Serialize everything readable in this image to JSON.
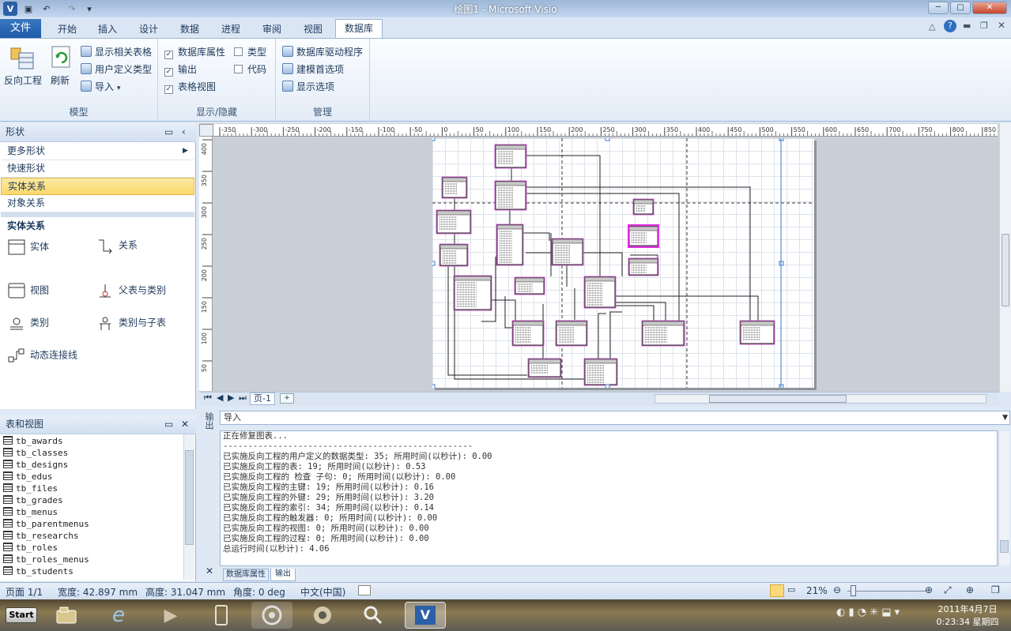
{
  "window": {
    "title": "绘图1 - Microsoft Visio"
  },
  "tabs": {
    "file": "文件",
    "items": [
      "开始",
      "插入",
      "设计",
      "数据",
      "进程",
      "审阅",
      "视图",
      "数据库"
    ]
  },
  "ribbon": {
    "model_group": {
      "label": "模型",
      "reverse": "反向工程",
      "refresh": "刷新",
      "show_related": "显示相关表格",
      "udt": "用户定义类型",
      "import": "导入"
    },
    "show_group": {
      "label": "显示/隐藏",
      "db_props": "数据库属性",
      "output": "输出",
      "table_view": "表格视图",
      "types": "类型",
      "code": "代码"
    },
    "manage_group": {
      "label": "管理",
      "driver": "数据库驱动程序",
      "modeling": "建模首选项",
      "display": "显示选项"
    }
  },
  "shapes_pane": {
    "title": "形状",
    "items": [
      "更多形状",
      "快速形状",
      "实体关系",
      "对象关系"
    ],
    "stencil_title": "实体关系",
    "stencil": [
      "实体",
      "关系",
      "视图",
      "父表与类别",
      "类别",
      "类别与子表",
      "动态连接线"
    ]
  },
  "tables_pane": {
    "title": "表和视图",
    "items": [
      "tb_awards",
      "tb_classes",
      "tb_designs",
      "tb_edus",
      "tb_files",
      "tb_grades",
      "tb_menus",
      "tb_parentmenus",
      "tb_researchs",
      "tb_roles",
      "tb_roles_menus",
      "tb_students"
    ]
  },
  "page_tabs": {
    "page": "页-1"
  },
  "output": {
    "side_label": "输出",
    "dropdown": "导入",
    "lines": [
      "正在修复图表...",
      "--------------------------------------------------",
      "已实施反向工程的用户定义的数据类型: 35; 所用时间(以秒计): 0.00",
      "已实施反向工程的表: 19; 所用时间(以秒计): 0.53",
      "已实施反向工程的 检查 子句: 0; 所用时间(以秒计): 0.00",
      "已实施反向工程的主键: 19; 所用时间(以秒计): 0.16",
      "已实施反向工程的外键: 29; 所用时间(以秒计): 3.20",
      "已实施反向工程的索引: 34; 所用时间(以秒计): 0.14",
      "已实施反向工程的触发器: 0; 所用时间(以秒计): 0.00",
      "已实施反向工程的视图: 0; 所用时间(以秒计): 0.00",
      "已实施反向工程的过程: 0; 所用时间(以秒计): 0.00",
      "总运行时间(以秒计): 4.06"
    ],
    "tabs": [
      "数据库属性",
      "输出"
    ]
  },
  "status": {
    "page": "页面 1/1",
    "width": "宽度: 42.897 mm",
    "height": "高度: 31.047 mm",
    "angle": "角度: 0 deg",
    "lang": "中文(中国)",
    "zoom": "21%"
  },
  "taskbar": {
    "start": "Start",
    "date": "2011年4月7日",
    "time": "0:23:34 星期四"
  },
  "ruler": {
    "h": [
      "-350",
      "-300",
      "-250",
      "-200",
      "-150",
      "-100",
      "-50",
      "0",
      "50",
      "100",
      "150",
      "200",
      "250",
      "300",
      "350",
      "400",
      "450",
      "500",
      "550",
      "600",
      "650",
      "700",
      "750",
      "800",
      "850"
    ],
    "v": [
      "400",
      "350",
      "300",
      "250",
      "200",
      "150",
      "100",
      "50"
    ]
  }
}
